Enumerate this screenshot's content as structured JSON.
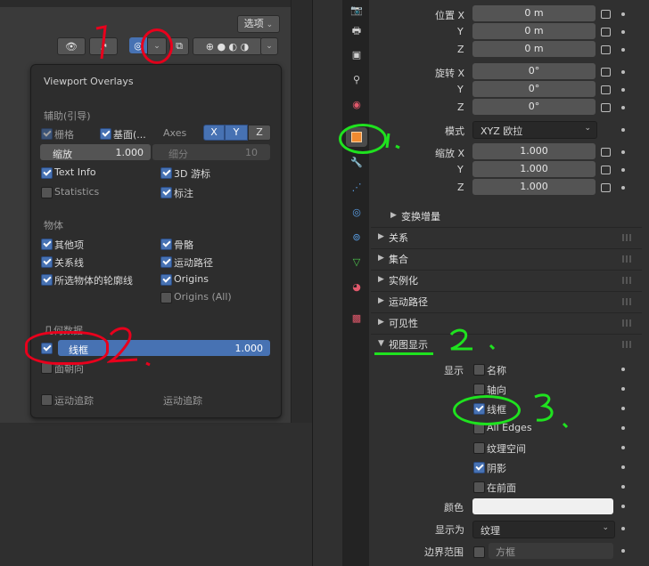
{
  "left": {
    "mode_button": "选项",
    "overlay": {
      "title": "Viewport Overlays",
      "guides_header": "辅助(引导)",
      "grid": "栅格",
      "floor": "基面(...",
      "axes": "Axes",
      "axis_x": "X",
      "axis_y": "Y",
      "axis_z": "Z",
      "scale_label": "缩放",
      "scale_value": "1.000",
      "subdiv_label": "细分",
      "subdiv_value": "10",
      "text_info": "Text Info",
      "gizmo_3d": "3D 游标",
      "statistics": "Statistics",
      "annotations": "标注",
      "objects_header": "物体",
      "extras": "其他项",
      "bones": "骨骼",
      "relations": "关系线",
      "motion_paths": "运动路径",
      "outline": "所选物体的轮廓线",
      "origins": "Origins",
      "origins_all": "Origins (All)",
      "geometry_header": "几何数据",
      "wireframe_label": "线框",
      "wireframe_value": "1.000",
      "face_orient": "面朝向",
      "motion_tracking": "运动追踪",
      "motion_tracking2": "运动追踪"
    },
    "annotations": {
      "step1": "1.",
      "step2": "2."
    }
  },
  "right": {
    "location": {
      "label": "位置 X",
      "y": "Y",
      "z": "Z",
      "values": [
        "0 m",
        "0 m",
        "0 m"
      ]
    },
    "rotation": {
      "label": "旋转 X",
      "y": "Y",
      "z": "Z",
      "values": [
        "0°",
        "0°",
        "0°"
      ]
    },
    "mode_label": "模式",
    "mode_value": "XYZ 欧拉",
    "scale": {
      "label": "缩放 X",
      "y": "Y",
      "z": "Z",
      "values": [
        "1.000",
        "1.000",
        "1.000"
      ]
    },
    "delta": "变换增量",
    "sections": [
      "关系",
      "集合",
      "实例化",
      "运动路径",
      "可见性"
    ],
    "viewport_display": "视图显示",
    "show_label": "显示",
    "show_items": [
      {
        "label": "名称",
        "checked": false
      },
      {
        "label": "轴向",
        "checked": false
      },
      {
        "label": "线框",
        "checked": true
      },
      {
        "label": "All Edges",
        "checked": false
      },
      {
        "label": "纹理空间",
        "checked": false
      },
      {
        "label": "阴影",
        "checked": true
      },
      {
        "label": "在前面",
        "checked": false
      }
    ],
    "color_label": "颜色",
    "display_as_label": "显示为",
    "display_as_value": "纹理",
    "bounds_label": "边界范围",
    "bounds_value": "方框",
    "annotations": {
      "step1": "1.",
      "step2": "2.",
      "step3": "3."
    }
  },
  "colors": {
    "accent": "#4772b3",
    "annot_red": "#e8001c",
    "annot_green": "#1fe21f"
  }
}
